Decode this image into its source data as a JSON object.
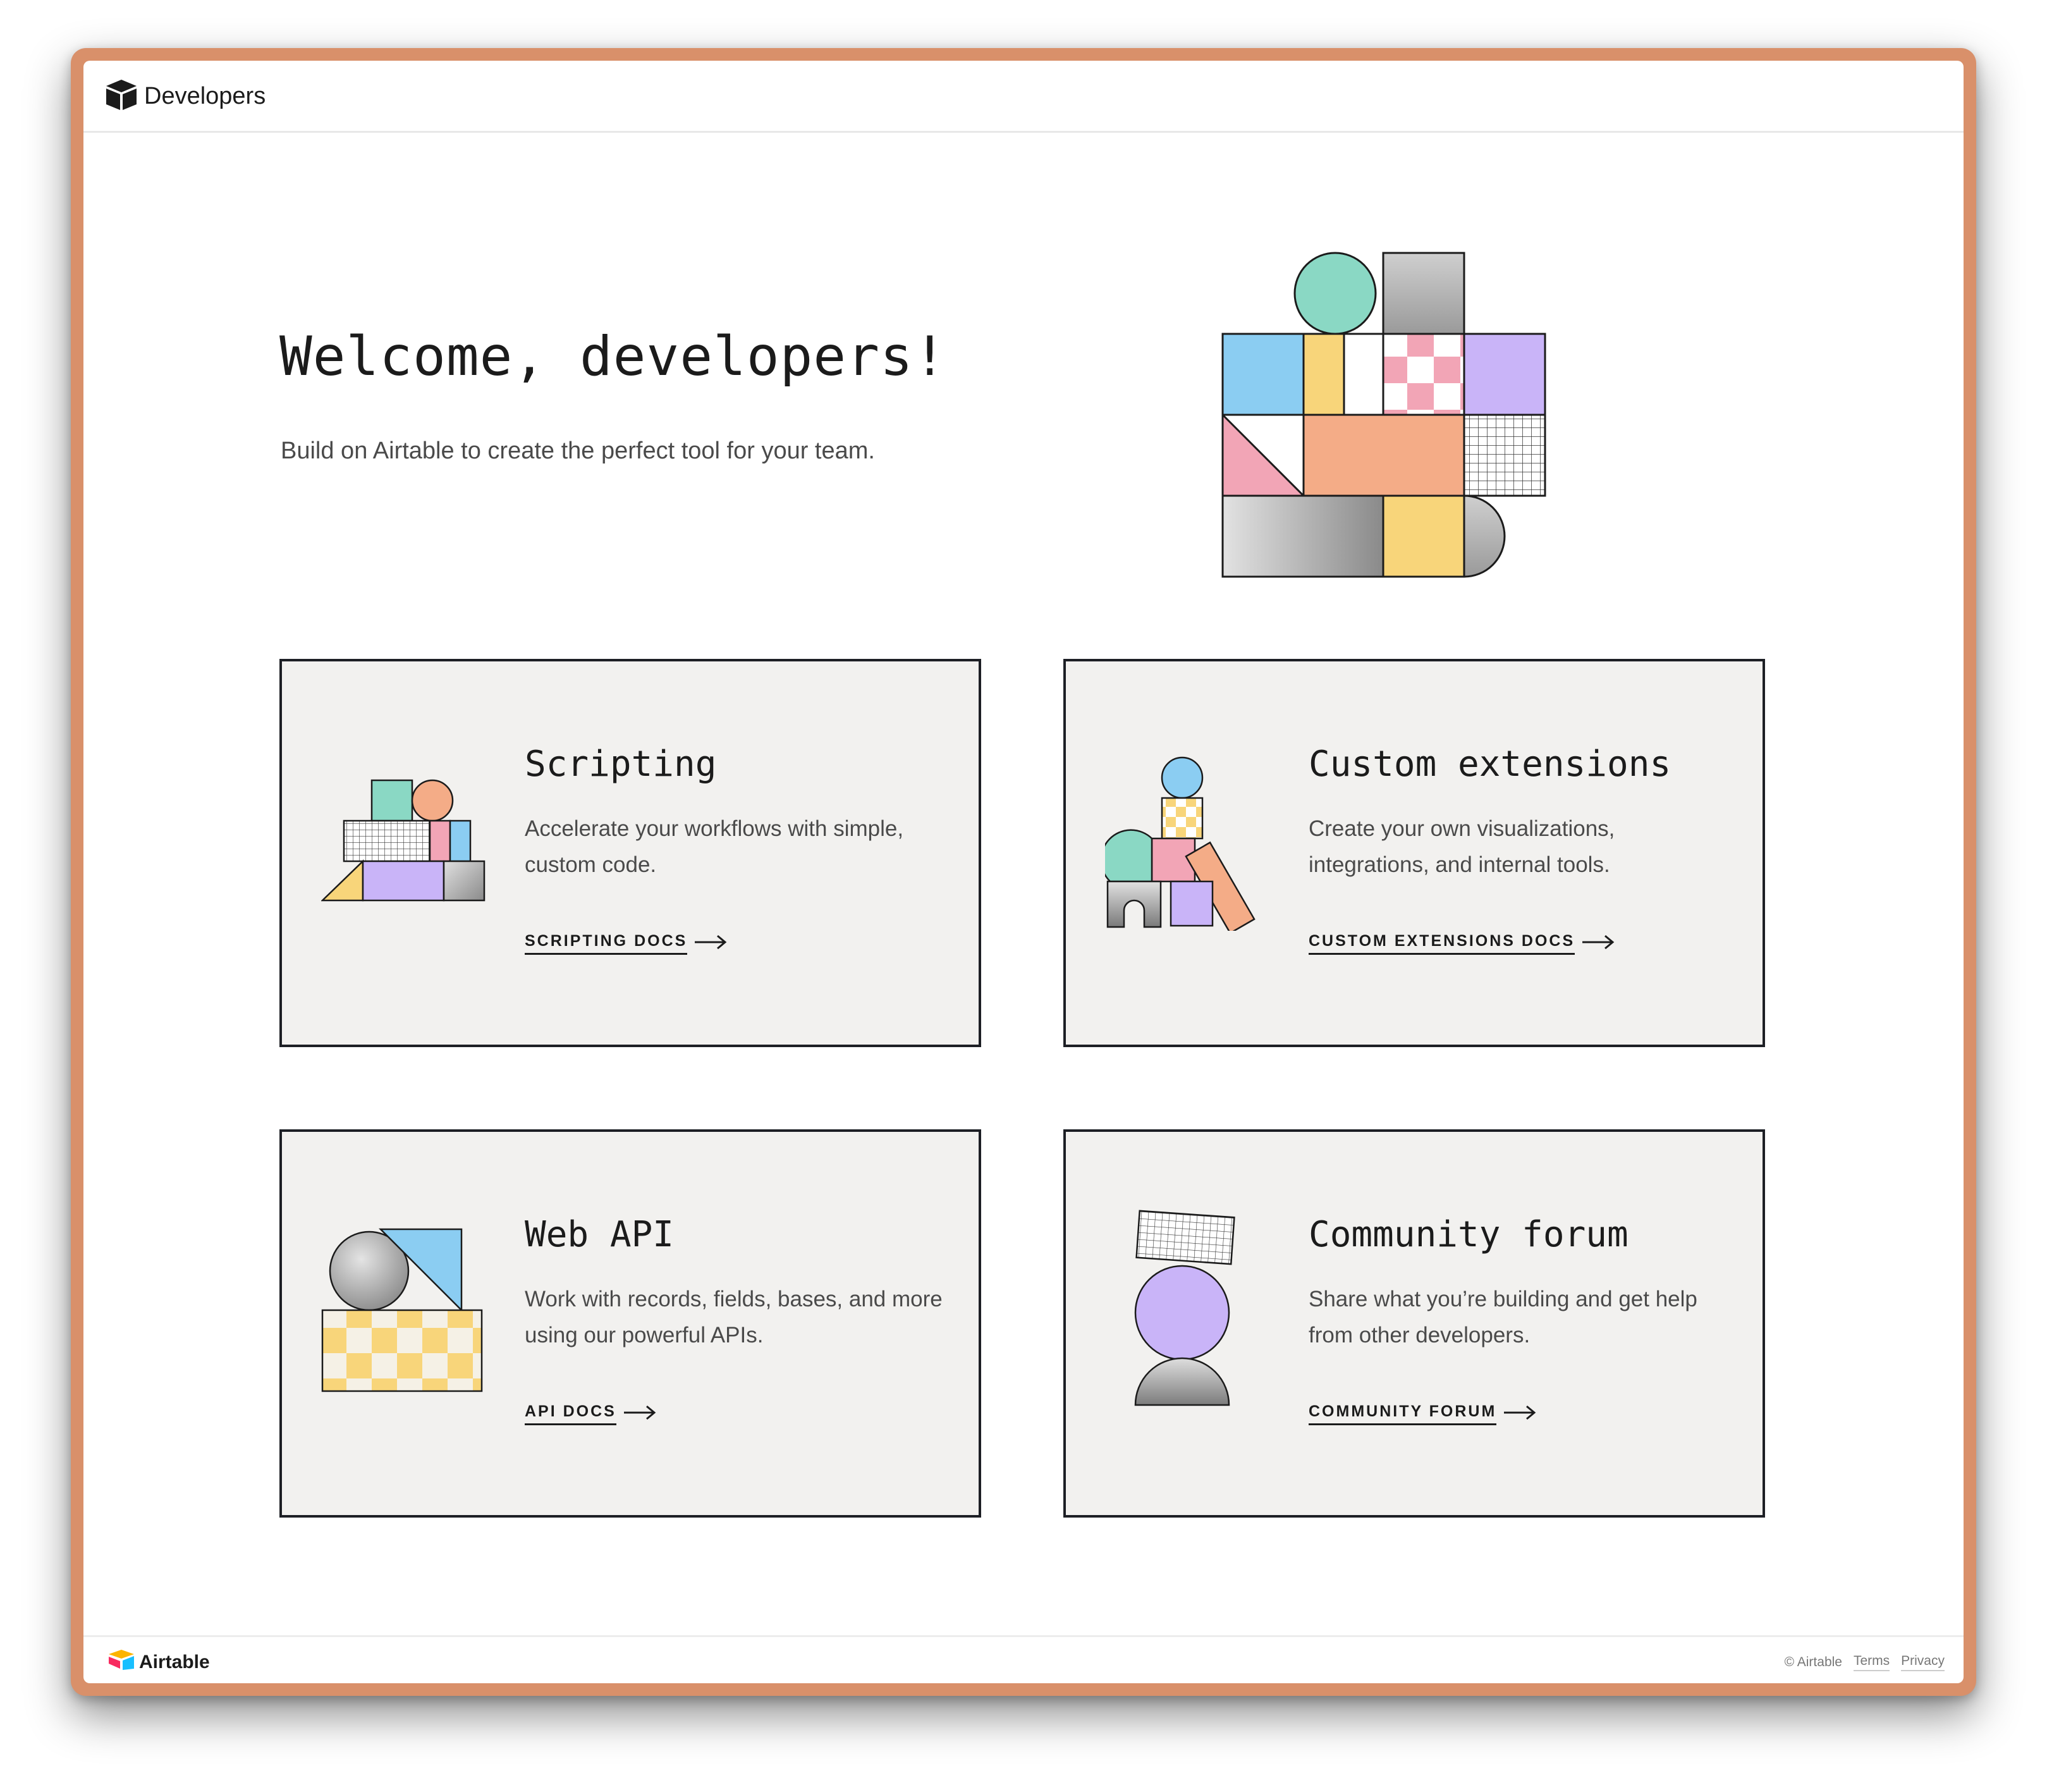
{
  "header": {
    "title": "Developers"
  },
  "hero": {
    "title": "Welcome, developers!",
    "subtitle": "Build on Airtable to create the perfect tool for your team."
  },
  "cards": [
    {
      "title": "Scripting",
      "description": "Accelerate your workflows with simple, custom code.",
      "link": "SCRIPTING DOCS"
    },
    {
      "title": "Custom extensions",
      "description": "Create your own visualizations, integrations, and internal tools.",
      "link": "CUSTOM EXTENSIONS DOCS"
    },
    {
      "title": "Web API",
      "description": "Work with records, fields, bases, and more using our powerful APIs.",
      "link": "API DOCS"
    },
    {
      "title": "Community forum",
      "description": "Share what you’re building and get help from other developers.",
      "link": "COMMUNITY FORUM"
    }
  ],
  "footer": {
    "brand": "Airtable",
    "copyright": "© Airtable",
    "terms": "Terms",
    "privacy": "Privacy"
  },
  "colors": {
    "frame": "#d9906a",
    "card_bg": "#f2f1ef",
    "card_border": "#1d1f25",
    "mint": "#8ad8c4",
    "sky": "#8bcdf2",
    "yellow": "#f8d57a",
    "pink": "#f2a5b6",
    "lavender": "#c9b4f8",
    "peach": "#f4ac87"
  }
}
